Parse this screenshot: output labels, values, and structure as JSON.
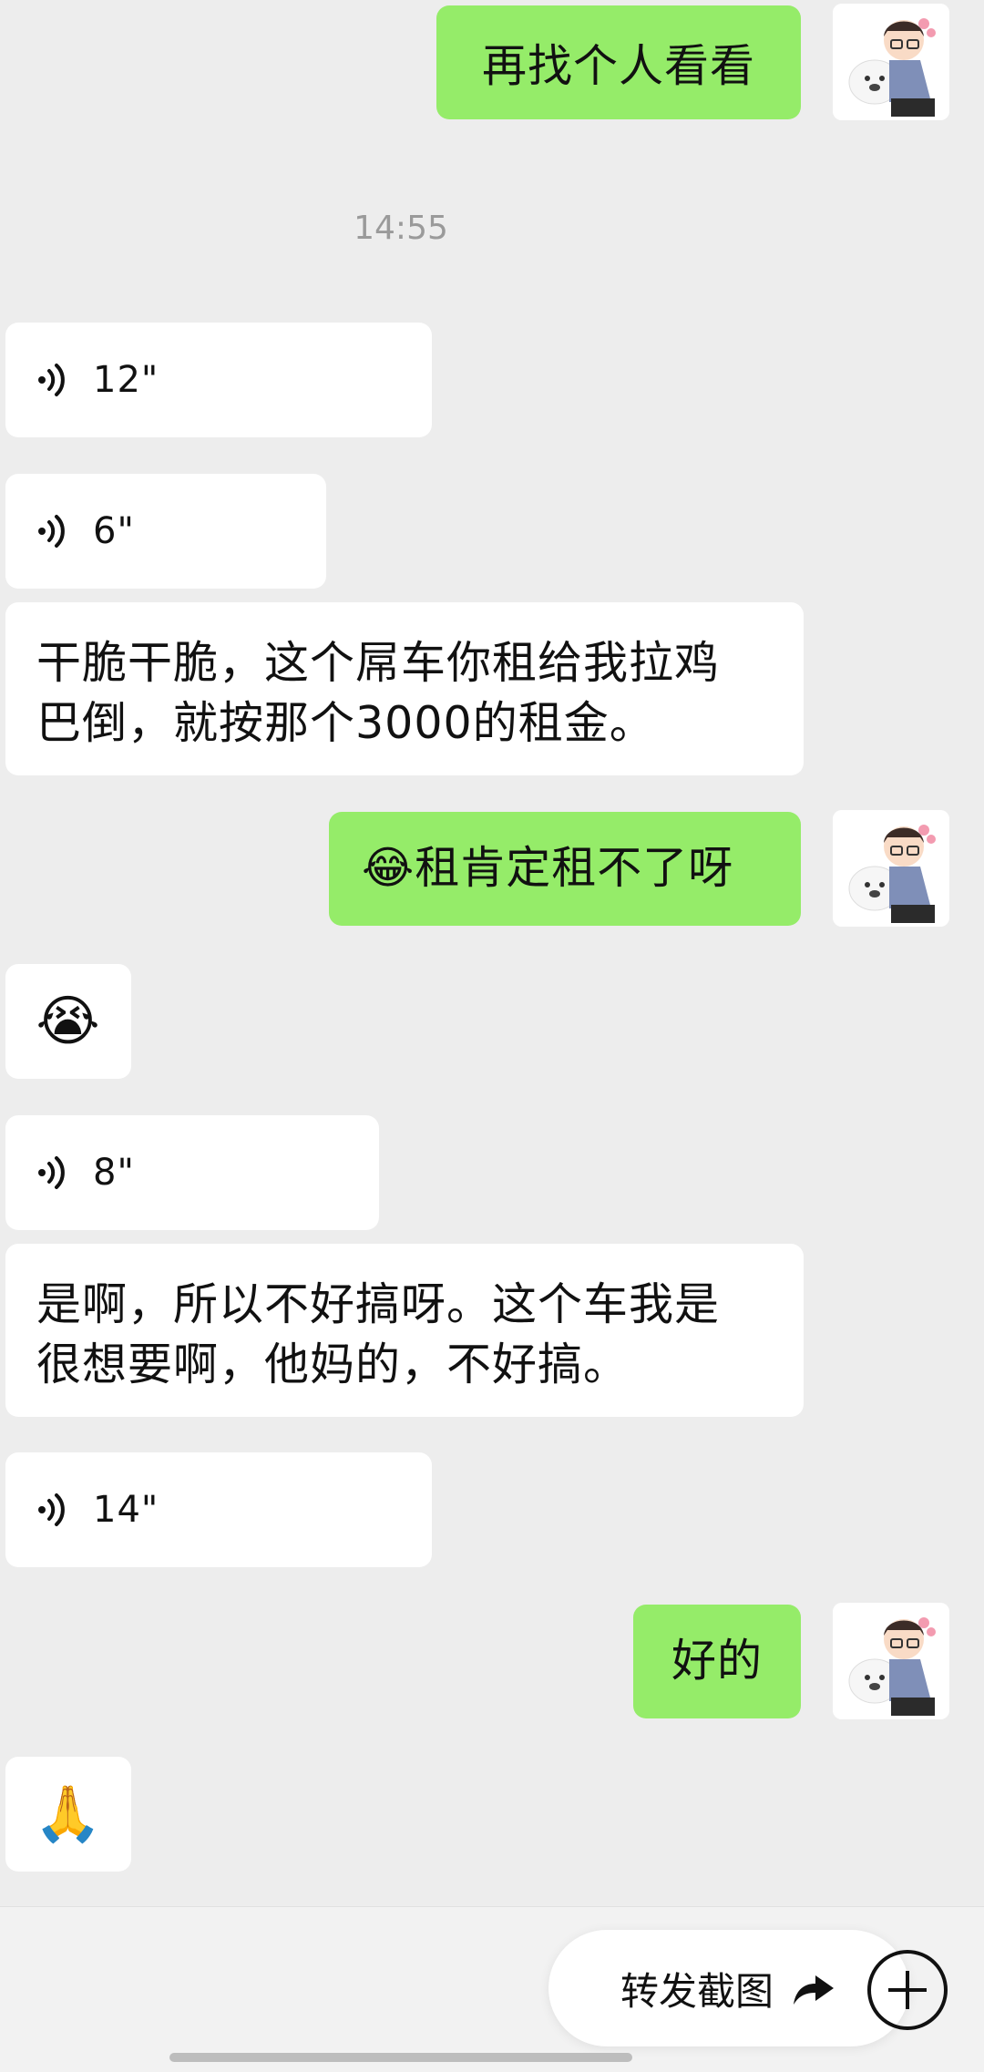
{
  "timestamp": "14:55",
  "messages": [
    {
      "kind": "text",
      "side": "out",
      "text": "再找个人看看"
    },
    {
      "kind": "voice",
      "side": "in",
      "duration": "12\""
    },
    {
      "kind": "voice",
      "side": "in",
      "duration": "6\""
    },
    {
      "kind": "text",
      "side": "in",
      "text": "干脆干脆，这个屌车你租给我拉鸡\n巴倒，就按那个3000的租金。"
    },
    {
      "kind": "text",
      "side": "out",
      "text": "😂租肯定租不了呀"
    },
    {
      "kind": "emoji",
      "side": "in",
      "text": "😭"
    },
    {
      "kind": "voice",
      "side": "in",
      "duration": "8\""
    },
    {
      "kind": "text",
      "side": "in",
      "text": "是啊，所以不好搞呀。这个车我是\n很想要啊，他妈的，不好搞。"
    },
    {
      "kind": "voice",
      "side": "in",
      "duration": "14\""
    },
    {
      "kind": "text",
      "side": "out",
      "text": "好的"
    },
    {
      "kind": "emoji",
      "side": "in",
      "text": "🙏"
    }
  ],
  "bottom_bar": {
    "forward_label": "转发截图"
  },
  "icons": {
    "voice": "voice-wave-icon",
    "forward": "share-arrow-icon",
    "plus": "plus-circle-icon"
  },
  "colors": {
    "outgoing_bubble": "#95ec69",
    "incoming_bubble": "#ffffff",
    "background": "#ededed"
  }
}
